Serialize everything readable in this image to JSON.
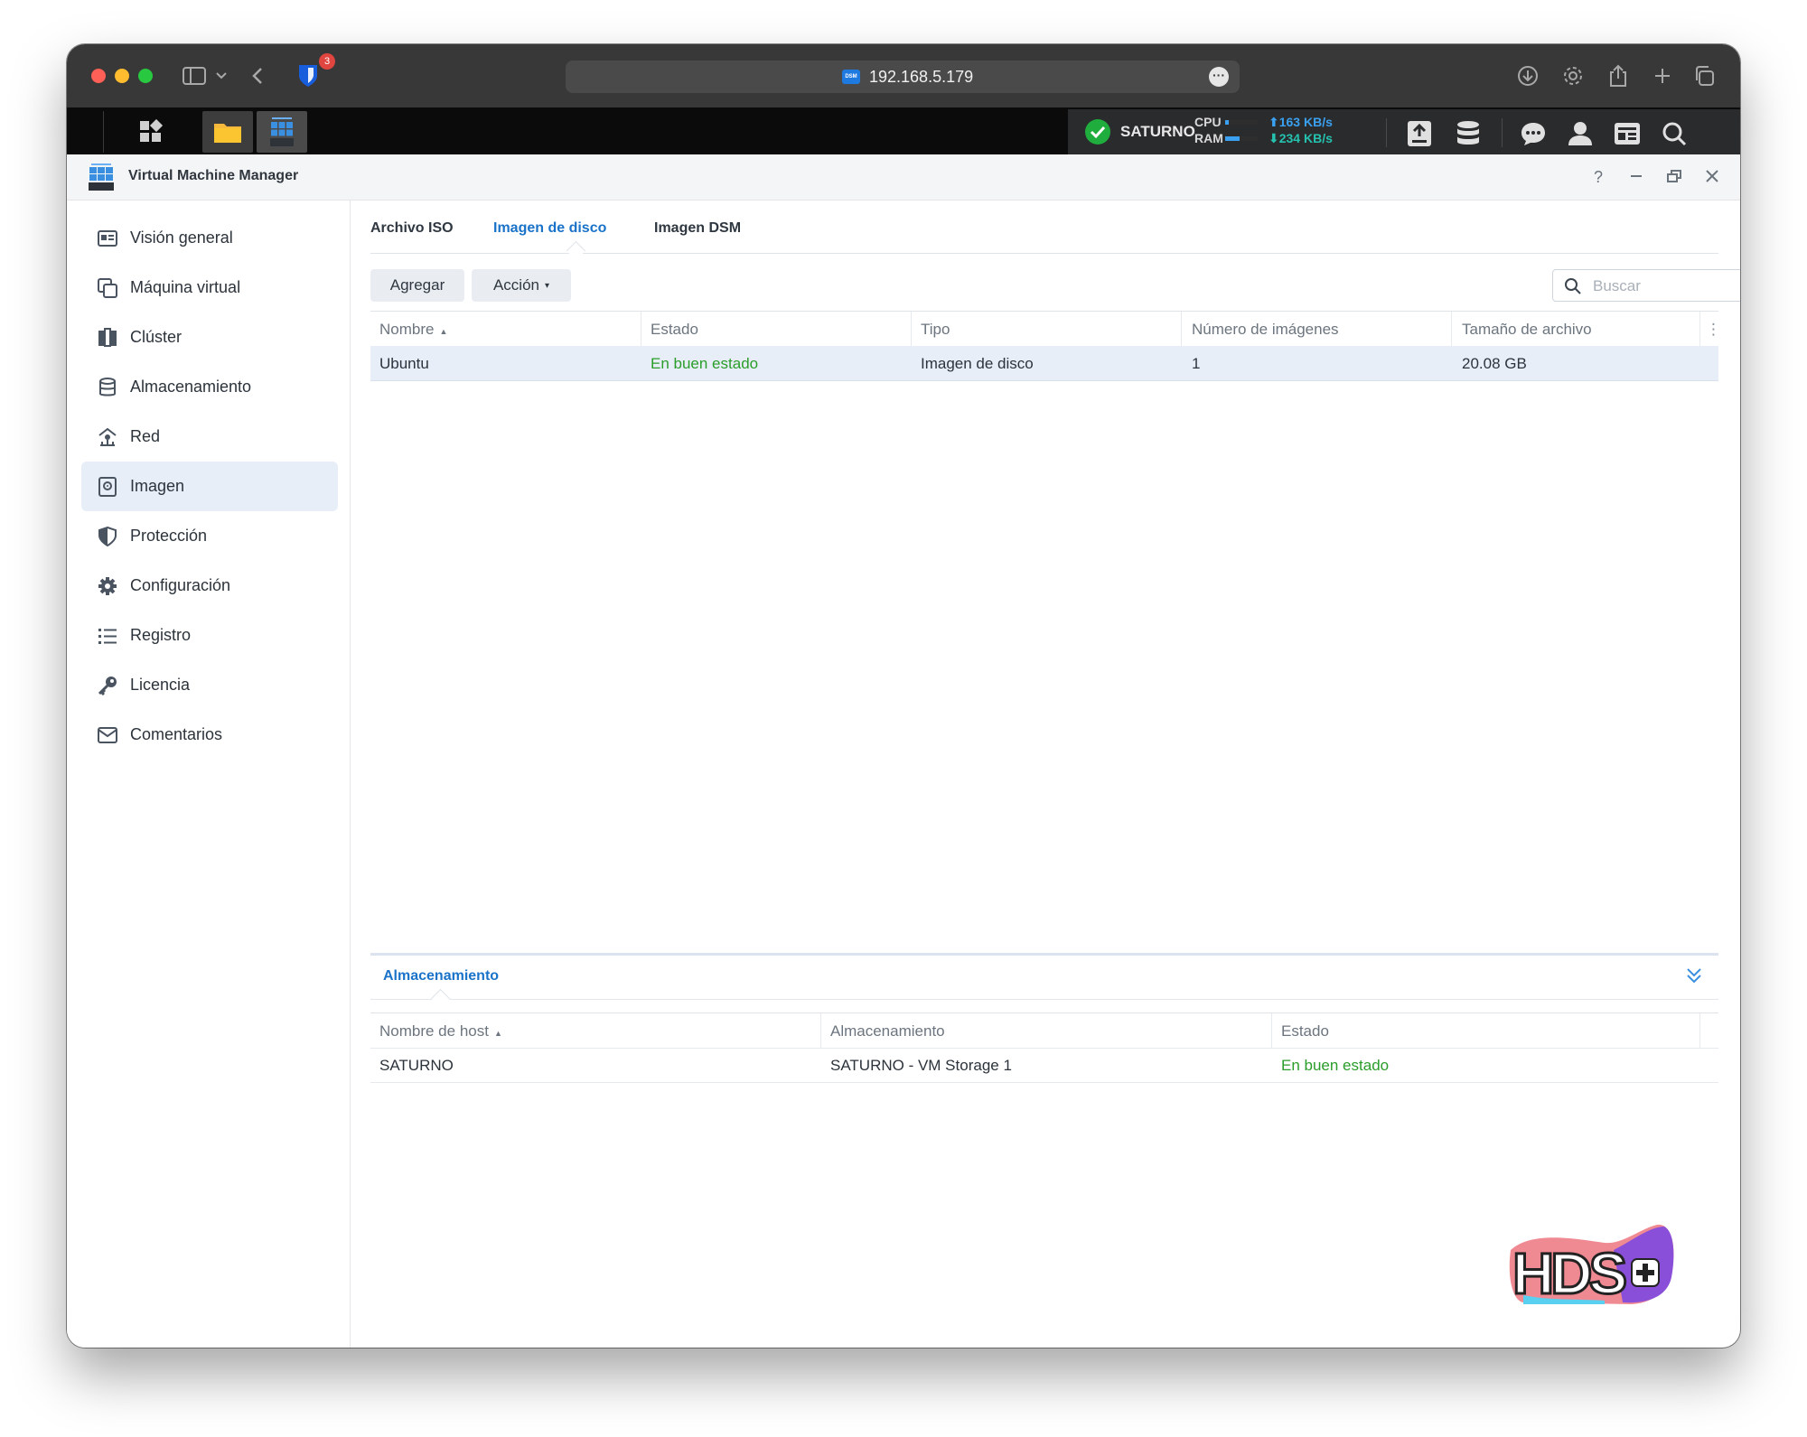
{
  "browser": {
    "url": "192.168.5.179",
    "favicon_label": "DSM",
    "extension_badge_count": "3"
  },
  "taskbar": {
    "server_name": "SATURNO",
    "cpu_label": "CPU",
    "ram_label": "RAM",
    "cpu_usage": 0.12,
    "ram_usage": 0.45,
    "upload_rate": "163 KB/s",
    "download_rate": "234 KB/s",
    "upload_color": "#3aa0ef",
    "download_color": "#25c2b0"
  },
  "app": {
    "title": "Virtual Machine Manager",
    "help": "?"
  },
  "sidebar": {
    "items": [
      {
        "label": "Visión general",
        "icon": "overview-icon"
      },
      {
        "label": "Máquina virtual",
        "icon": "virtual-machine-icon"
      },
      {
        "label": "Clúster",
        "icon": "cluster-icon"
      },
      {
        "label": "Almacenamiento",
        "icon": "storage-icon"
      },
      {
        "label": "Red",
        "icon": "network-icon"
      },
      {
        "label": "Imagen",
        "icon": "image-icon",
        "active": true
      },
      {
        "label": "Protección",
        "icon": "shield-icon"
      },
      {
        "label": "Configuración",
        "icon": "gear-icon"
      },
      {
        "label": "Registro",
        "icon": "log-list-icon"
      },
      {
        "label": "Licencia",
        "icon": "key-icon"
      },
      {
        "label": "Comentarios",
        "icon": "mail-icon"
      }
    ]
  },
  "tabs": [
    {
      "label": "Archivo ISO"
    },
    {
      "label": "Imagen de disco",
      "active": true
    },
    {
      "label": "Imagen DSM"
    }
  ],
  "toolbar": {
    "add_label": "Agregar",
    "action_label": "Acción",
    "search_placeholder": "Buscar"
  },
  "images_table": {
    "columns": [
      "Nombre",
      "Estado",
      "Tipo",
      "Número de imágenes",
      "Tamaño de archivo"
    ],
    "rows": [
      {
        "nombre": "Ubuntu",
        "estado": "En buen estado",
        "tipo": "Imagen de disco",
        "numero": "1",
        "tamano": "20.08 GB"
      }
    ]
  },
  "storage_panel": {
    "title": "Almacenamiento",
    "columns": [
      "Nombre de host",
      "Almacenamiento",
      "Estado"
    ],
    "rows": [
      {
        "host": "SATURNO",
        "almacenamiento": "SATURNO - VM Storage 1",
        "estado": "En buen estado"
      }
    ]
  },
  "watermark": {
    "text": "HDS+"
  },
  "colors": {
    "accent": "#1a73c9",
    "ok": "#2a9d2a",
    "selected_row": "#e7eef8"
  }
}
